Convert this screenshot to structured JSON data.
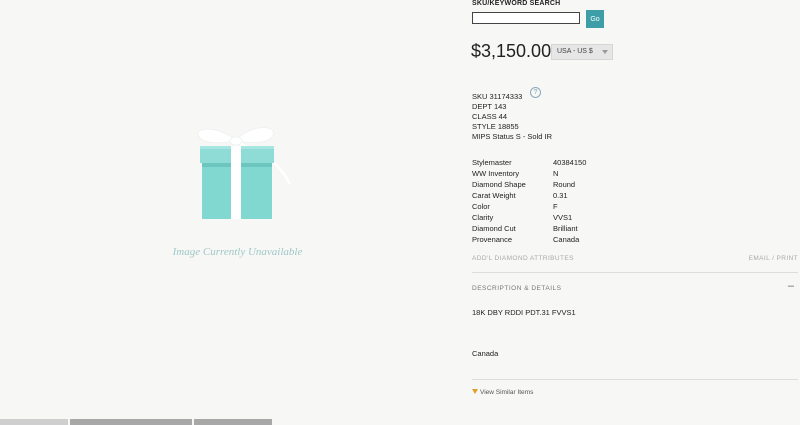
{
  "image": {
    "caption": "Image Currently Unavailable",
    "box_color": "#81d8d0",
    "ribbon_color": "#ffffff"
  },
  "search": {
    "label": "SKU/KEYWORD SEARCH",
    "value": "",
    "placeholder": "",
    "go_label": "Go"
  },
  "price": {
    "amount": "$3,150.00",
    "currency": "USA - US $"
  },
  "sku_info": {
    "sku": "SKU 31174333",
    "dept": "DEPT 143",
    "class": "CLASS 44",
    "style": "STYLE 18855",
    "mips": "MIPS Status S - Sold IR",
    "help_icon": "?"
  },
  "attributes": [
    {
      "key": "Stylemaster",
      "value": "40384150"
    },
    {
      "key": "WW Inventory",
      "value": "N"
    },
    {
      "key": "Diamond Shape",
      "value": "Round"
    },
    {
      "key": "Carat Weight",
      "value": "0.31"
    },
    {
      "key": "Color",
      "value": "F"
    },
    {
      "key": "Clarity",
      "value": "VVS1"
    },
    {
      "key": "Diamond Cut",
      "value": "Brilliant"
    },
    {
      "key": "Provenance",
      "value": "Canada"
    }
  ],
  "links": {
    "additional_attributes": "ADD'L DIAMOND ATTRIBUTES",
    "email_print": "EMAIL / PRINT",
    "view_similar": "View Similar Items"
  },
  "description": {
    "header": "DESCRIPTION & DETAILS",
    "toggle": "–",
    "text": "18K DBY RDDI PDT.31 FVVS1",
    "origin": "Canada"
  },
  "colors": {
    "accent": "#3d9ea8",
    "tiffany_blue": "#81d8d0"
  }
}
